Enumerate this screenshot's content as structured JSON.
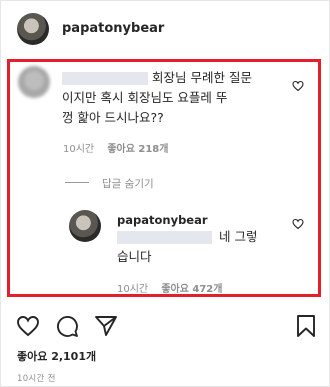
{
  "post": {
    "username": "papatonybear"
  },
  "comment": {
    "text_line1": "회장님 무례한 질문",
    "text_line2": "이지만 혹시 회장님도 요플레 뚜",
    "text_line3": "껑 핥아 드시나요??",
    "time": "10시간",
    "likes": "좋아요 218개"
  },
  "hide_replies_label": "답글 숨기기",
  "reply": {
    "username": "papatonybear",
    "text_line1": "네 그렇",
    "text_line2": "습니다",
    "time": "10시간",
    "likes": "좋아요 472개"
  },
  "footer": {
    "likes_label": "좋아요 2,101개",
    "time_ago": "10시간 전"
  },
  "colors": {
    "highlight_border": "#e41e2c",
    "text_primary": "#262626",
    "text_secondary": "#8e8e8e"
  },
  "icons": [
    "heart-icon",
    "comment-icon",
    "share-icon",
    "bookmark-icon"
  ]
}
